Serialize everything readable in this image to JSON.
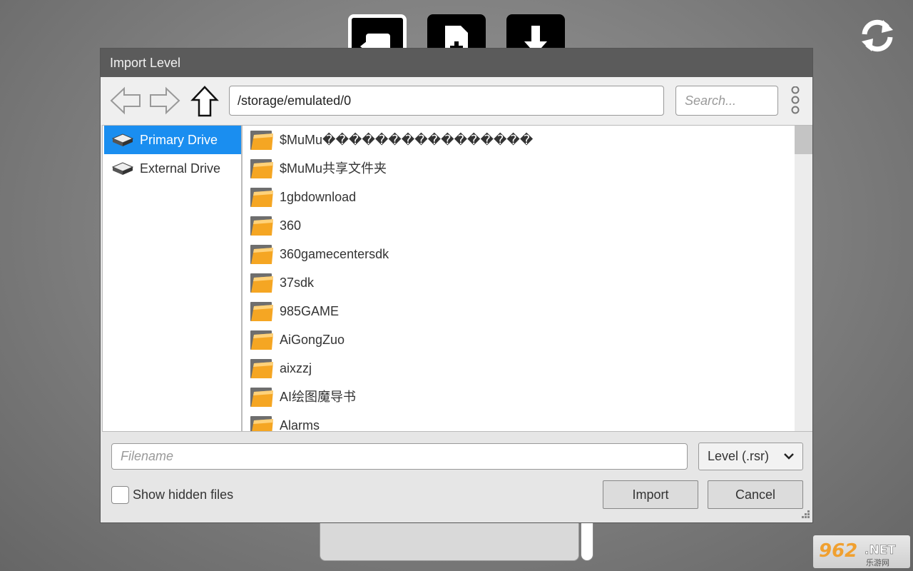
{
  "toolbar": {
    "buttons": [
      {
        "name": "exit-icon"
      },
      {
        "name": "new-file-icon"
      },
      {
        "name": "download-icon"
      }
    ],
    "refresh_icon": "refresh-icon"
  },
  "dialog": {
    "title": "Import Level",
    "nav": {
      "back_icon": "arrow-left-icon",
      "forward_icon": "arrow-right-icon",
      "up_icon": "arrow-up-icon",
      "path": "/storage/emulated/0",
      "search_placeholder": "Search...",
      "menu_icon": "vertical-dots-icon"
    },
    "drives": [
      {
        "label": "Primary Drive",
        "selected": true
      },
      {
        "label": "External Drive",
        "selected": false
      }
    ],
    "files": [
      "$MuMu����������������",
      "$MuMu共享文件夹",
      "1gbdownload",
      "360",
      "360gamecentersdk",
      "37sdk",
      "985GAME",
      "AiGongZuo",
      "aixzzj",
      "AI绘图魔导书",
      "Alarms"
    ],
    "filename_placeholder": "Filename",
    "file_type": "Level (.rsr)",
    "show_hidden_label": "Show hidden files",
    "show_hidden_checked": false,
    "import_label": "Import",
    "cancel_label": "Cancel"
  },
  "colors": {
    "selected": "#1a8ef0",
    "title_bar": "#5b5b5b",
    "folder": "#f5a623"
  }
}
